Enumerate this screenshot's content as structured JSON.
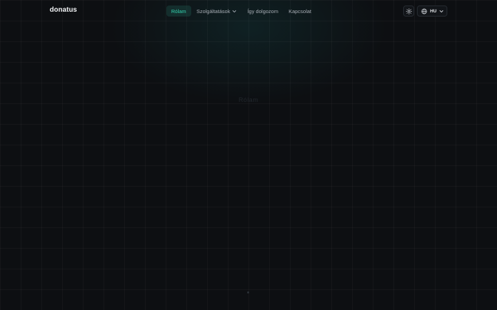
{
  "brand": {
    "name": "donatus"
  },
  "nav": {
    "items": [
      {
        "label": "Rólam",
        "active": true
      },
      {
        "label": "Szolgáltatások",
        "has_dropdown": true
      },
      {
        "label": "Így dolgozom"
      },
      {
        "label": "Kapcsolat"
      }
    ]
  },
  "controls": {
    "theme_icon": "sun-icon",
    "language": {
      "icon": "globe-icon",
      "value": "HU"
    }
  },
  "hero": {
    "faint_text": "Rólam"
  },
  "colors": {
    "background": "#0d0f12",
    "accent": "#34d3b0",
    "active_bg": "#153c38"
  }
}
